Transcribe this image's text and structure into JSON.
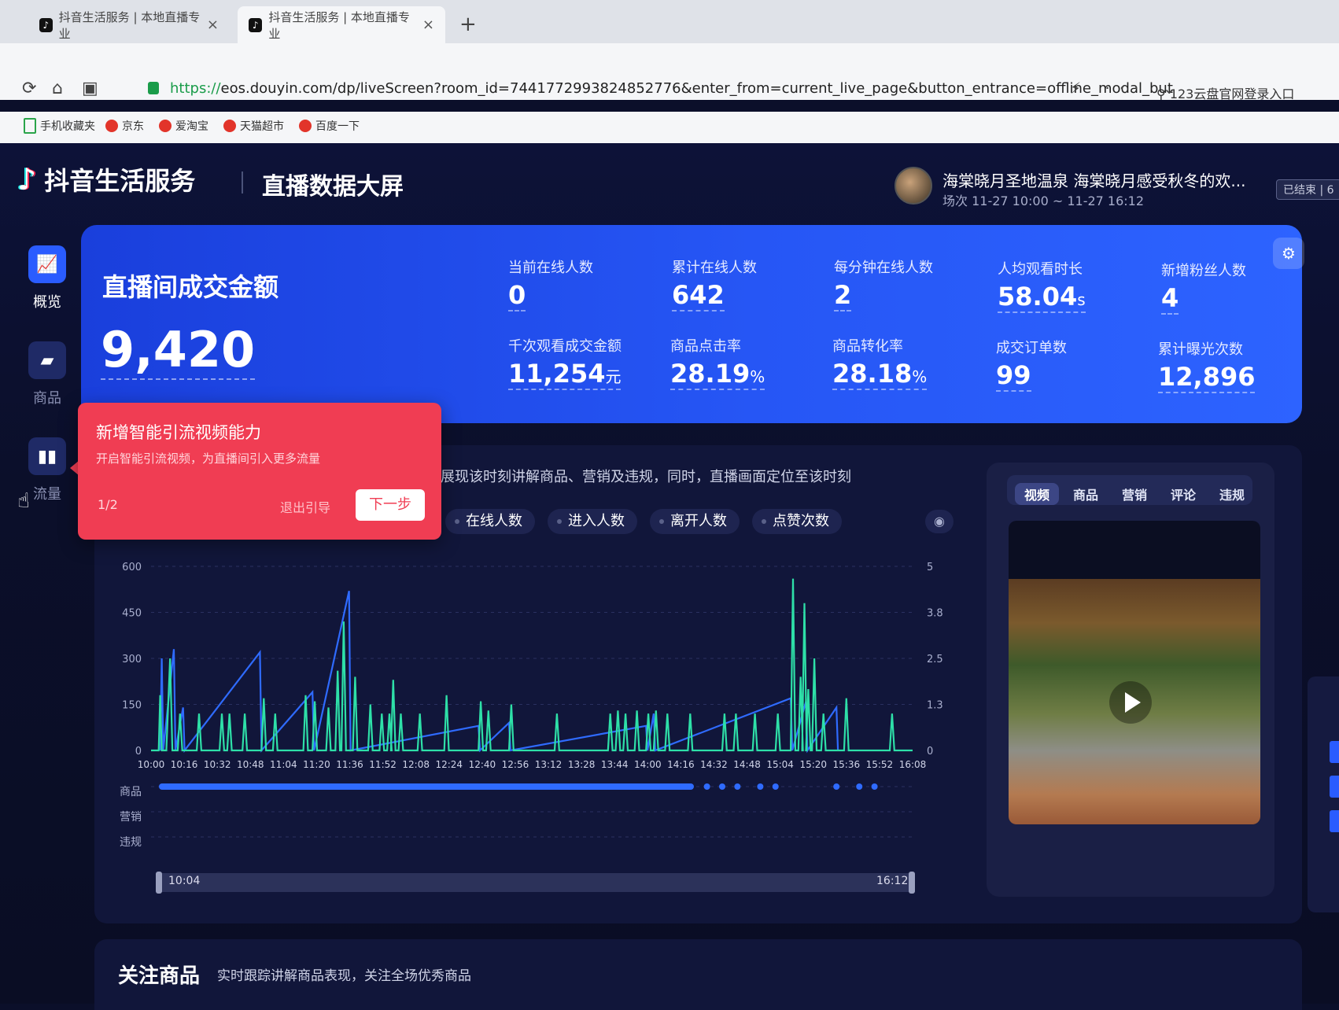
{
  "browser": {
    "tabs": [
      {
        "label": "抖音生活服务 | 本地直播专业",
        "close": "×"
      },
      {
        "label": "抖音生活服务 | 本地直播专业",
        "close": "×"
      }
    ],
    "new_tab": "+",
    "url_scheme": "https://",
    "url_rest": "eos.douyin.com/dp/liveScreen?room_id=7441772993824852776&enter_from=current_live_page&button_entrance=offline_modal_but",
    "url_actions": "⚡ ··· ⌄",
    "search_placeholder": "123云盘官网登录入口",
    "bookmarks": [
      "手机收藏夹",
      "京东",
      "爱淘宝",
      "天猫超市",
      "百度一下"
    ]
  },
  "header": {
    "brand": "抖音生活服务",
    "screen_title": "直播数据大屏",
    "room_title": "海棠晓月圣地温泉 海棠晓月感受秋冬的欢...",
    "room_time": "场次 11-27 10:00 ~ 11-27 16:12",
    "status": "已结束 | 6"
  },
  "sidebar": [
    {
      "label": "概览",
      "icon": "chart-icon",
      "active": true
    },
    {
      "label": "商品",
      "icon": "bag-icon",
      "active": false
    },
    {
      "label": "流量",
      "icon": "traffic-icon",
      "active": false
    }
  ],
  "metrics": {
    "gmv_label": "直播间成交金额",
    "gmv_value": "9,420",
    "items": [
      {
        "label": "当前在线人数",
        "value": "0",
        "unit": ""
      },
      {
        "label": "累计在线人数",
        "value": "642",
        "unit": ""
      },
      {
        "label": "每分钟在线人数",
        "value": "2",
        "unit": ""
      },
      {
        "label": "人均观看时长",
        "value": "58.04",
        "unit": "s"
      },
      {
        "label": "新增粉丝人数",
        "value": "4",
        "unit": ""
      },
      {
        "label": "千次观看成交金额",
        "value": "11,254",
        "unit": "元"
      },
      {
        "label": "商品点击率",
        "value": "28.19",
        "unit": "%"
      },
      {
        "label": "商品转化率",
        "value": "28.18",
        "unit": "%"
      },
      {
        "label": "成交订单数",
        "value": "99",
        "unit": ""
      },
      {
        "label": "累计曝光次数",
        "value": "12,896",
        "unit": ""
      }
    ]
  },
  "trend": {
    "description": "展现该时刻讲解商品、营销及违规，同时，直播画面定位至该时刻",
    "chips": [
      "在线人数",
      "进入人数",
      "离开人数",
      "点赞次数"
    ],
    "lanes": [
      "商品",
      "营销",
      "违规"
    ],
    "slider_start": "10:04",
    "slider_end": "16:12"
  },
  "chart_data": {
    "type": "line",
    "x": [
      "10:00",
      "10:16",
      "10:32",
      "10:48",
      "11:04",
      "11:20",
      "11:36",
      "11:52",
      "12:08",
      "12:24",
      "12:40",
      "12:56",
      "13:12",
      "13:28",
      "13:44",
      "14:00",
      "14:16",
      "14:32",
      "14:48",
      "15:04",
      "15:20",
      "15:36",
      "15:52",
      "16:08"
    ],
    "y_left_ticks": [
      "600",
      "450",
      "300",
      "150",
      "0"
    ],
    "y_right_ticks": [
      "5",
      "3.8",
      "2.5",
      "1.3",
      "0"
    ],
    "ylim_left": [
      0,
      600
    ],
    "ylim_right": [
      0,
      5
    ],
    "series": [
      {
        "color": "#2f6bff",
        "axis": "left",
        "points": [
          [
            0.012,
            0
          ],
          [
            0.014,
            300
          ],
          [
            0.016,
            0
          ],
          [
            0.03,
            330
          ],
          [
            0.032,
            0
          ],
          [
            0.042,
            140
          ],
          [
            0.044,
            0
          ],
          [
            0.143,
            320
          ],
          [
            0.145,
            0
          ],
          [
            0.212,
            190
          ],
          [
            0.214,
            0
          ],
          [
            0.26,
            520
          ],
          [
            0.262,
            0
          ],
          [
            0.43,
            80
          ],
          [
            0.432,
            0
          ],
          [
            0.47,
            90
          ],
          [
            0.472,
            0
          ],
          [
            0.65,
            80
          ],
          [
            0.652,
            0
          ],
          [
            0.66,
            120
          ],
          [
            0.662,
            0
          ],
          [
            0.84,
            170
          ],
          [
            0.842,
            0
          ],
          [
            0.86,
            160
          ],
          [
            0.862,
            0
          ],
          [
            0.9,
            140
          ],
          [
            0.902,
            0
          ]
        ]
      },
      {
        "color": "#2ee0a8",
        "axis": "left",
        "points": [
          [
            0.0,
            0
          ],
          [
            0.01,
            0
          ],
          [
            0.012,
            180
          ],
          [
            0.014,
            0
          ],
          [
            0.02,
            0
          ],
          [
            0.025,
            300
          ],
          [
            0.028,
            0
          ],
          [
            0.035,
            0
          ],
          [
            0.038,
            120
          ],
          [
            0.041,
            0
          ],
          [
            0.06,
            0
          ],
          [
            0.063,
            120
          ],
          [
            0.066,
            0
          ],
          [
            0.09,
            0
          ],
          [
            0.093,
            120
          ],
          [
            0.096,
            0
          ],
          [
            0.1,
            0
          ],
          [
            0.103,
            120
          ],
          [
            0.106,
            0
          ],
          [
            0.12,
            0
          ],
          [
            0.123,
            120
          ],
          [
            0.126,
            0
          ],
          [
            0.145,
            0
          ],
          [
            0.148,
            170
          ],
          [
            0.151,
            0
          ],
          [
            0.16,
            0
          ],
          [
            0.163,
            120
          ],
          [
            0.166,
            0
          ],
          [
            0.2,
            0
          ],
          [
            0.203,
            180
          ],
          [
            0.206,
            0
          ],
          [
            0.212,
            0
          ],
          [
            0.215,
            160
          ],
          [
            0.218,
            0
          ],
          [
            0.23,
            0
          ],
          [
            0.233,
            140
          ],
          [
            0.236,
            0
          ],
          [
            0.242,
            0
          ],
          [
            0.245,
            260
          ],
          [
            0.248,
            0
          ],
          [
            0.25,
            0
          ],
          [
            0.253,
            420
          ],
          [
            0.256,
            0
          ],
          [
            0.265,
            0
          ],
          [
            0.268,
            240
          ],
          [
            0.271,
            0
          ],
          [
            0.285,
            0
          ],
          [
            0.288,
            150
          ],
          [
            0.291,
            0
          ],
          [
            0.3,
            0
          ],
          [
            0.303,
            120
          ],
          [
            0.306,
            0
          ],
          [
            0.31,
            0
          ],
          [
            0.313,
            120
          ],
          [
            0.316,
            0
          ],
          [
            0.315,
            0
          ],
          [
            0.318,
            230
          ],
          [
            0.321,
            0
          ],
          [
            0.325,
            0
          ],
          [
            0.328,
            120
          ],
          [
            0.331,
            0
          ],
          [
            0.35,
            0
          ],
          [
            0.353,
            120
          ],
          [
            0.356,
            0
          ],
          [
            0.385,
            0
          ],
          [
            0.388,
            180
          ],
          [
            0.391,
            0
          ],
          [
            0.43,
            0
          ],
          [
            0.433,
            160
          ],
          [
            0.436,
            0
          ],
          [
            0.44,
            0
          ],
          [
            0.443,
            130
          ],
          [
            0.446,
            0
          ],
          [
            0.47,
            0
          ],
          [
            0.473,
            150
          ],
          [
            0.476,
            0
          ],
          [
            0.53,
            0
          ],
          [
            0.533,
            120
          ],
          [
            0.536,
            0
          ],
          [
            0.6,
            0
          ],
          [
            0.603,
            120
          ],
          [
            0.606,
            0
          ],
          [
            0.61,
            0
          ],
          [
            0.613,
            130
          ],
          [
            0.616,
            0
          ],
          [
            0.62,
            0
          ],
          [
            0.623,
            120
          ],
          [
            0.626,
            0
          ],
          [
            0.635,
            0
          ],
          [
            0.638,
            130
          ],
          [
            0.641,
            0
          ],
          [
            0.65,
            0
          ],
          [
            0.653,
            120
          ],
          [
            0.656,
            0
          ],
          [
            0.66,
            0
          ],
          [
            0.663,
            130
          ],
          [
            0.666,
            0
          ],
          [
            0.675,
            0
          ],
          [
            0.678,
            120
          ],
          [
            0.681,
            0
          ],
          [
            0.705,
            0
          ],
          [
            0.708,
            120
          ],
          [
            0.711,
            0
          ],
          [
            0.75,
            0
          ],
          [
            0.753,
            120
          ],
          [
            0.756,
            0
          ],
          [
            0.765,
            0
          ],
          [
            0.768,
            120
          ],
          [
            0.771,
            0
          ],
          [
            0.79,
            0
          ],
          [
            0.793,
            120
          ],
          [
            0.796,
            0
          ],
          [
            0.82,
            0
          ],
          [
            0.823,
            120
          ],
          [
            0.826,
            0
          ],
          [
            0.84,
            0
          ],
          [
            0.843,
            560
          ],
          [
            0.846,
            0
          ],
          [
            0.85,
            0
          ],
          [
            0.853,
            240
          ],
          [
            0.856,
            0
          ],
          [
            0.855,
            0
          ],
          [
            0.858,
            480
          ],
          [
            0.861,
            0
          ],
          [
            0.86,
            0
          ],
          [
            0.863,
            200
          ],
          [
            0.866,
            0
          ],
          [
            0.868,
            0
          ],
          [
            0.871,
            300
          ],
          [
            0.874,
            0
          ],
          [
            0.88,
            0
          ],
          [
            0.883,
            120
          ],
          [
            0.886,
            0
          ],
          [
            0.91,
            0
          ],
          [
            0.913,
            170
          ],
          [
            0.916,
            0
          ],
          [
            0.97,
            0
          ],
          [
            0.973,
            120
          ],
          [
            0.976,
            0
          ],
          [
            1.0,
            0
          ]
        ]
      }
    ]
  },
  "video_panel": {
    "tabs": [
      "视频",
      "商品",
      "营销",
      "评论",
      "违规"
    ]
  },
  "guide": {
    "title": "新增智能引流视频能力",
    "desc": "开启智能引流视频，为直播间引入更多流量",
    "step": "1/2",
    "exit": "退出引导",
    "next": "下一步"
  },
  "focus": {
    "title": "关注商品",
    "desc": "实时跟踪讲解商品表现，关注全场优秀商品"
  },
  "colors": {
    "accent": "#2656f5",
    "guide": "#f03d53",
    "line_green": "#2ee0a8",
    "line_blue": "#2f6bff"
  }
}
